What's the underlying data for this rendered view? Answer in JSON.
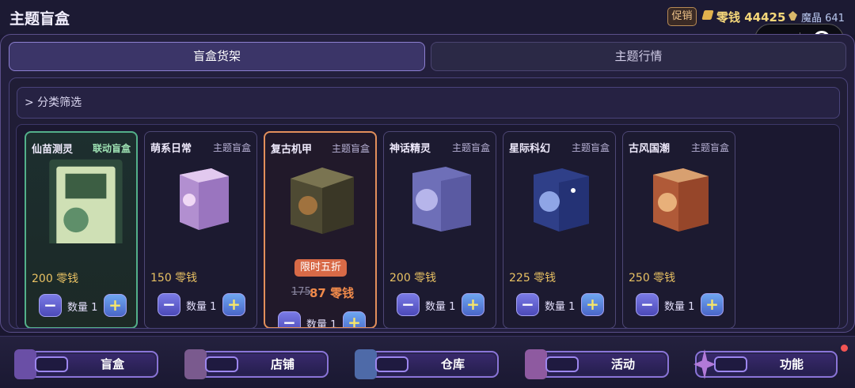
{
  "header": {
    "title": "主题盲盒",
    "promo_label": "促销",
    "coins_label": "零钱 44425",
    "gems_label": "魔晶 641",
    "more_glyph": "•●•"
  },
  "tabs": [
    {
      "label": "盲盒货架",
      "active": true
    },
    {
      "label": "主题行情",
      "active": false
    }
  ],
  "filter": {
    "label": "> 分类筛选"
  },
  "cards": [
    {
      "name": "仙苗测灵",
      "tag": "联动盲盒",
      "price": "200 零钱",
      "qty": "数量 1",
      "style": "green",
      "box_color": "#cfe0b5"
    },
    {
      "name": "萌系日常",
      "tag": "主题盲盒",
      "price": "150 零钱",
      "qty": "数量 1",
      "style": "normal",
      "box_color": "#c9a9de"
    },
    {
      "name": "复古机甲",
      "tag": "主题盲盒",
      "sale_badge": "限时五折",
      "old_price": "175",
      "new_price": "87 零钱",
      "qty": "数量 1",
      "style": "orange",
      "box_color": "#6a6040"
    },
    {
      "name": "神话精灵",
      "tag": "主题盲盒",
      "price": "200 零钱",
      "qty": "数量 1",
      "style": "normal",
      "box_color": "#7f84c8"
    },
    {
      "name": "星际科幻",
      "tag": "主题盲盒",
      "price": "225 零钱",
      "qty": "数量 1",
      "style": "normal",
      "box_color": "#3b4f9e"
    },
    {
      "name": "古风国潮",
      "tag": "主题盲盒",
      "price": "250 零钱",
      "qty": "数量 1",
      "style": "normal",
      "box_color": "#c06a45"
    }
  ],
  "stepper": {
    "minus": "−",
    "plus": "+"
  },
  "nav": [
    {
      "label": "盲盒",
      "icon": "blindbox-icon"
    },
    {
      "label": "店铺",
      "icon": "shop-icon"
    },
    {
      "label": "仓库",
      "icon": "warehouse-icon"
    },
    {
      "label": "活动",
      "icon": "event-icon"
    },
    {
      "label": "功能",
      "icon": "function-icon"
    }
  ],
  "colors": {
    "accent": "#8c7fd0",
    "price": "#e8c163",
    "sale": "#d86a47",
    "linked": "#53b08a"
  }
}
